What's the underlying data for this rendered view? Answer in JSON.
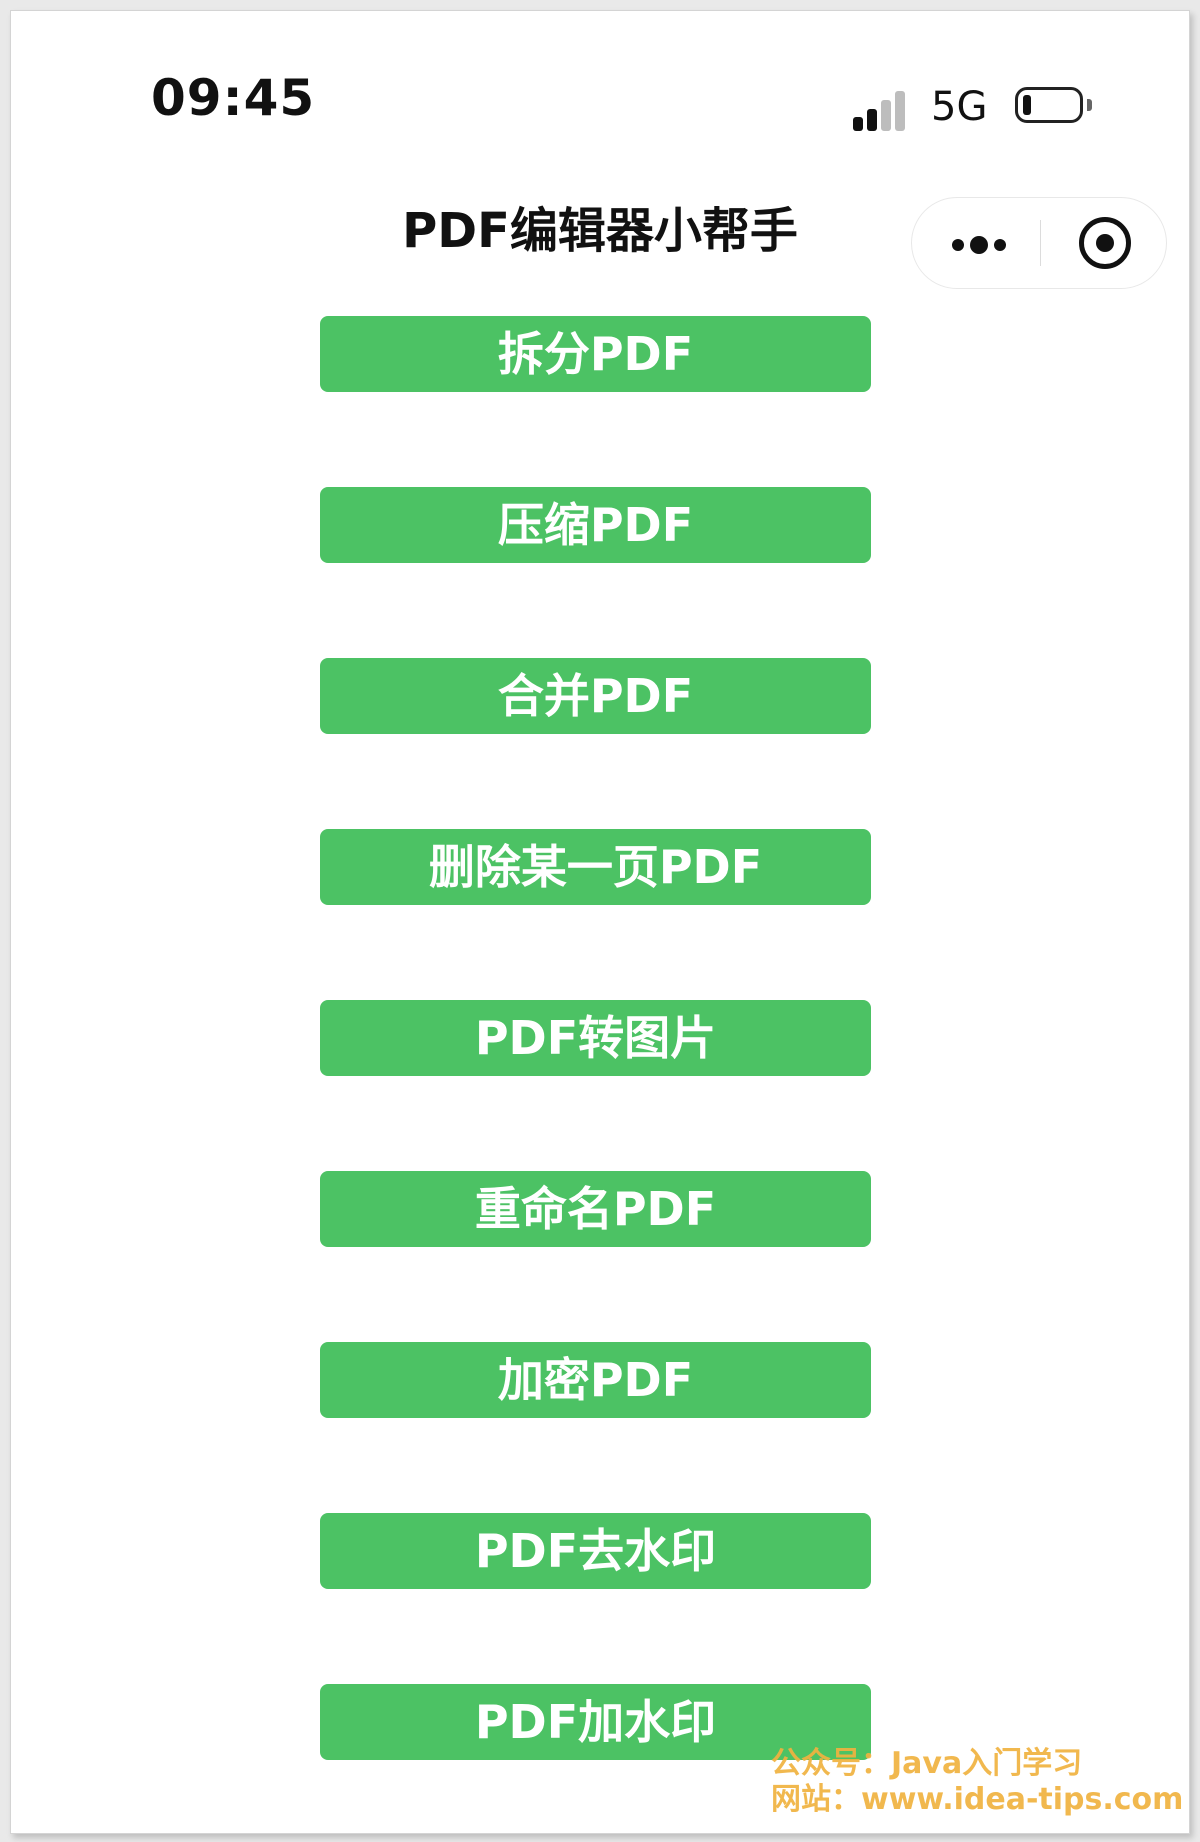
{
  "status_bar": {
    "time": "09:45",
    "network": "5G",
    "signal_bars_active": 2,
    "signal_bars_total": 4,
    "battery_level": 0.15
  },
  "nav": {
    "title": "PDF编辑器小帮手",
    "more_icon": "more-dots-icon",
    "close_icon": "target-circle-icon"
  },
  "buttons": [
    {
      "label": "拆分PDF"
    },
    {
      "label": "压缩PDF"
    },
    {
      "label": "合并PDF"
    },
    {
      "label": "删除某一页PDF"
    },
    {
      "label": "PDF转图片"
    },
    {
      "label": "重命名PDF"
    },
    {
      "label": "加密PDF"
    },
    {
      "label": "PDF去水印"
    },
    {
      "label": "PDF加水印"
    }
  ],
  "watermark": {
    "line1": "公众号：Java入门学习",
    "line2": "网站：www.idea-tips.com"
  },
  "colors": {
    "button_bg": "#4cc264",
    "button_text": "#ffffff",
    "watermark": "#f0b240",
    "signal_active": "#111111",
    "signal_inactive": "#bdbdbd"
  }
}
